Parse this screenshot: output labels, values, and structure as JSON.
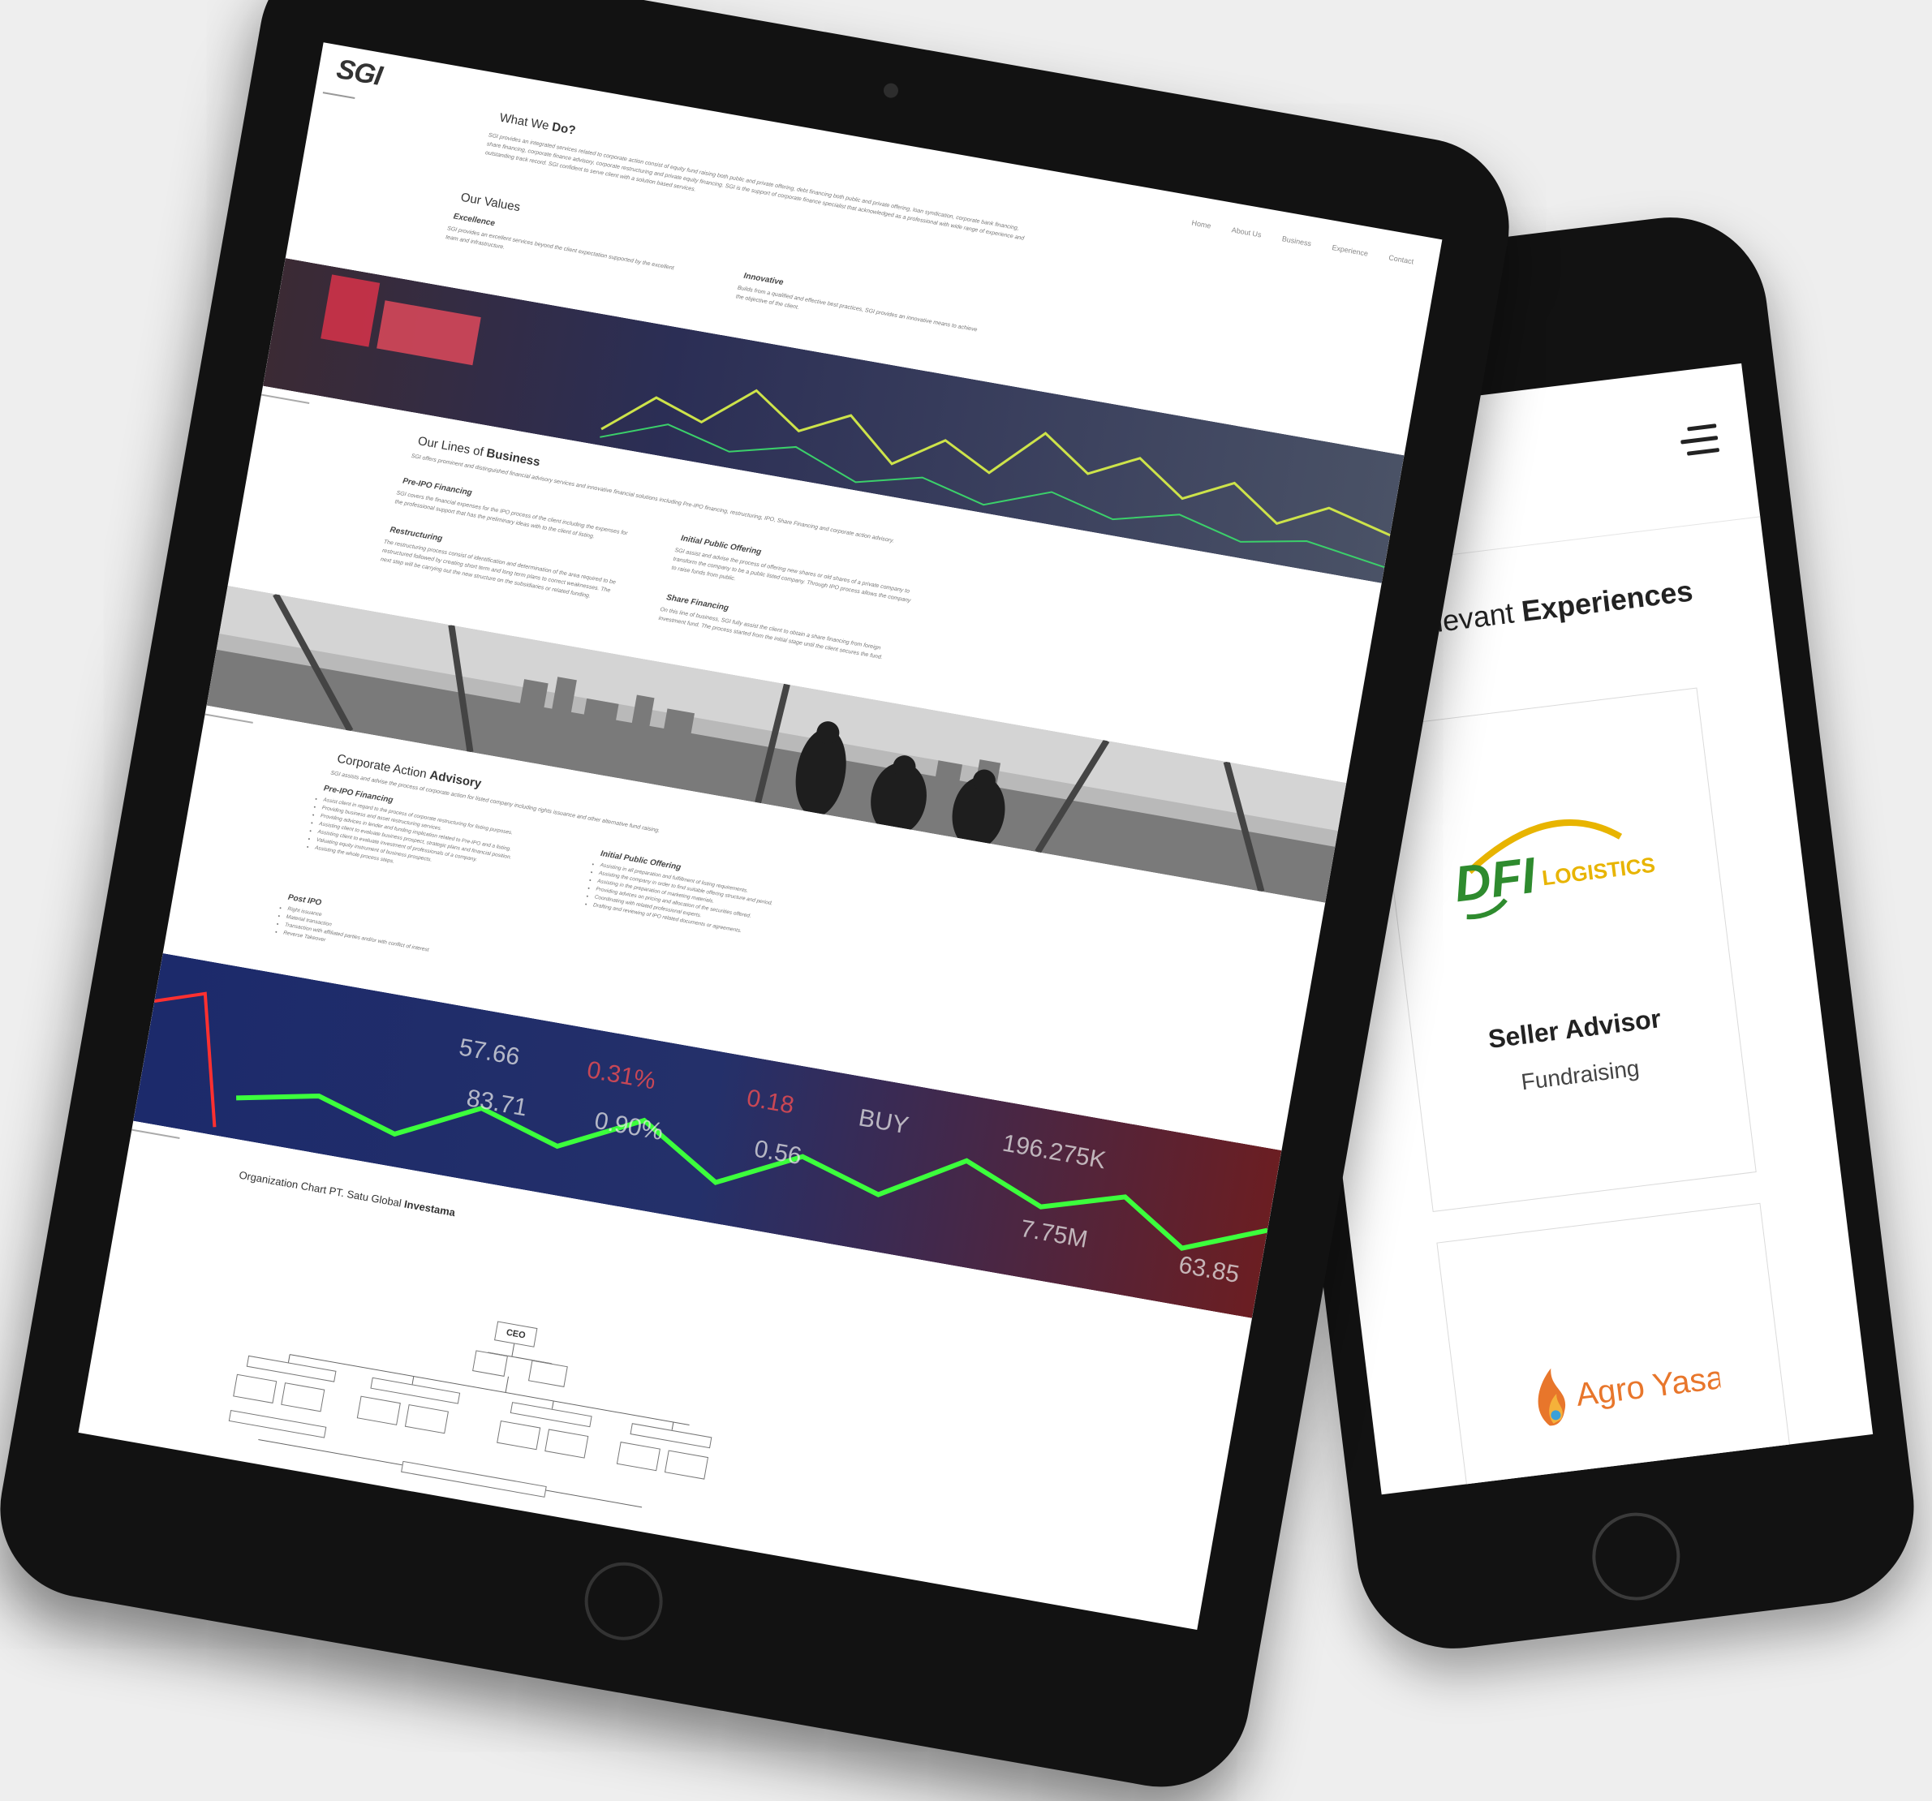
{
  "phone": {
    "heading_light": "SGI's Relevant",
    "heading_bold": "Experiences",
    "cards": [
      {
        "logo_main": "DFI",
        "logo_sub": "LOGISTICS",
        "title": "Seller Advisor",
        "subtitle": "Fundraising"
      },
      {
        "logo_text": "Agro Yasa"
      }
    ]
  },
  "tablet": {
    "logo": "SGI",
    "nav": [
      "Home",
      "About Us",
      "Business",
      "Experience",
      "Contact"
    ],
    "what_we_do": {
      "title_light": "What We ",
      "title_bold": "Do?",
      "text": "SGI provides an integrated services related to corporate action consist of equity fund raising both public and private offering, debt financing both public and private offering, loan syndication, corporate bank financing, share financing, corporate finance advisory, corporate restructuring and private equity financing. SGI is the support of corporate finance specialist that acknowledged as a professional with wide range of experience and outstanding track record. SGI confident to serve client with a solution based services."
    },
    "values": {
      "title": "Our Values",
      "items": [
        {
          "name": "Excellence",
          "text": "SGI provides an excellent services beyond the client expectation supported by the excellent team and infrastructure."
        },
        {
          "name": "Innovative",
          "text": "Builds from a qualified and effective best practices, SGI provides an innovative means to achieve the objective of the client."
        }
      ]
    },
    "business": {
      "title_light": "Our Lines of ",
      "title_bold": "Business",
      "intro": "SGI offers prominent and distinguished financial advisory services and innovative financial solutions including Pre-IPO financing, restructuring, IPO, Share Financing and corporate action advisory.",
      "items": [
        {
          "name": "Pre-IPO Financing",
          "text": "SGI covers the financial expenses for the IPO process of the client including the expenses for the professional support that has the preliminary ideas with to the client of listing."
        },
        {
          "name": "Initial Public Offering",
          "text": "SGI assist and advise the process of offering new shares or old shares of a private company to transform the company to be a public listed company. Through IPO process allows the company to raise funds from public."
        },
        {
          "name": "Restructuring",
          "text": "The restructuring process consist of identification and determination of the area required to be restructured followed by creating short term and long term plans to correct weaknesses. The next step will be carrying out the new structure on the subsidiaries or related funding."
        },
        {
          "name": "Share Financing",
          "text": "On this line of business, SGI fully assist the client to obtain a share financing from foreign investment fund. The process started from the initial stage until the client secures the fund."
        }
      ]
    },
    "corporate_action": {
      "title_light": "Corporate Action ",
      "title_bold": "Advisory",
      "intro": "SGI assists and advise the process of corporate action for listed company including rights issuance and other alternative fund raising.",
      "pre_ipo_title": "Pre-IPO Financing",
      "pre_ipo_items": [
        "Assist client in regard to the process of corporate restructuring for listing purposes.",
        "Providing business and asset restructuring services.",
        "Providing advices in lender and funding implication related to Pre-IPO and a listing.",
        "Assisting client to evaluate business prospect, strategic plans and financial position.",
        "Assisting client to evaluate investment of professionals of a company.",
        "Valuating equity instrument of business prospects.",
        "Assisting the whole process steps."
      ],
      "ipo_title": "Initial Public Offering",
      "ipo_items": [
        "Assisting in all preparation and fulfillment of listing requirements.",
        "Assisting the company in order to find suitable offering structure and period.",
        "Assisting in the preparation of marketing materials.",
        "Providing advices on pricing and allocation of the securities offered.",
        "Coordinating with related professional experts.",
        "Drafting and reviewing of IPO related documents or agreements."
      ],
      "post_ipo_title": "Post IPO",
      "post_ipo_items": [
        "Right issuance",
        "Material transaction",
        "Transaction with affiliated parties and/or with conflict of interest",
        "Reverse Takeover"
      ]
    },
    "org_chart": {
      "title_light": "Organization Chart PT. Satu Global ",
      "title_bold": "Investama",
      "ceo": "CEO"
    }
  },
  "colors": {
    "device": "#121212",
    "background": "#eeeeee",
    "dfi_green": "#2e8b2e",
    "dfi_yellow": "#e8b400",
    "agro_orange": "#e8762b"
  }
}
